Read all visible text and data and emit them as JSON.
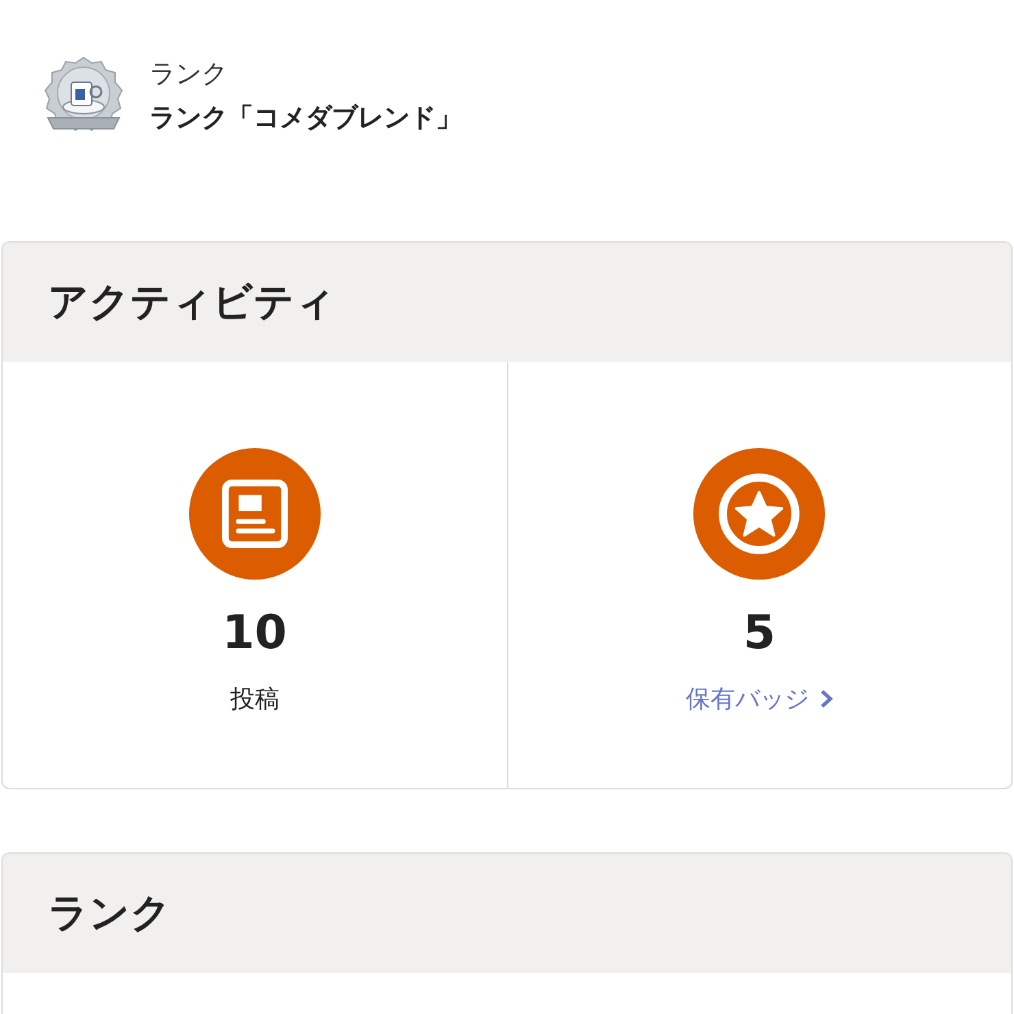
{
  "rank_header": {
    "label": "ランク",
    "value": "ランク「コメダブレンド」"
  },
  "activity": {
    "title": "アクティビティ",
    "stats": [
      {
        "kind": "posts",
        "value": "10",
        "label": "投稿",
        "link": false
      },
      {
        "kind": "badges",
        "value": "5",
        "label": "保有バッジ",
        "link": true
      }
    ]
  },
  "rank_section": {
    "title": "ランク"
  }
}
